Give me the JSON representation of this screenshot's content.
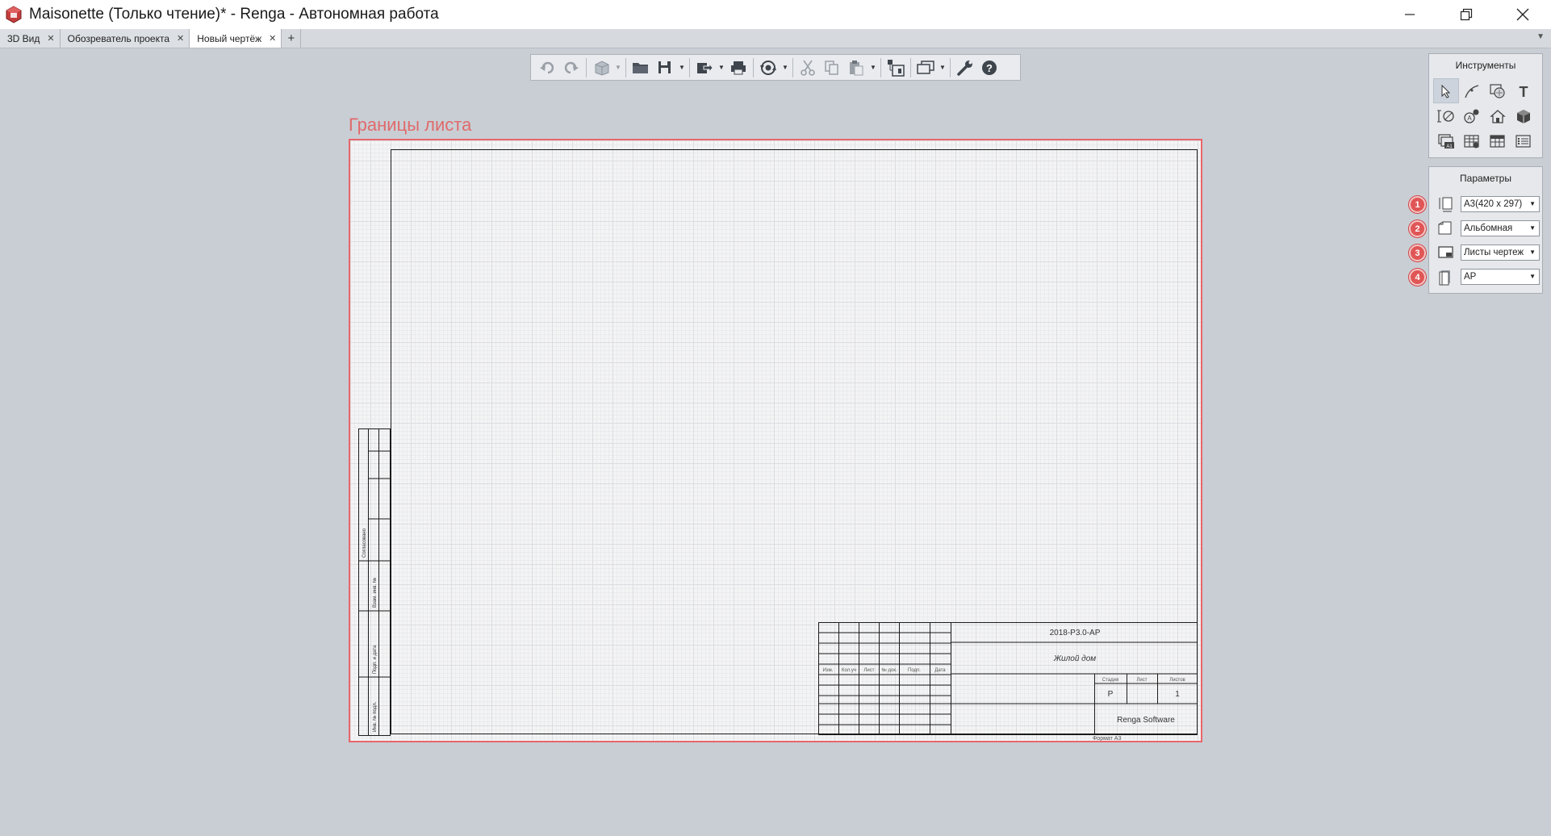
{
  "window": {
    "title": "Maisonette (Только чтение)* - Renga - Автономная работа"
  },
  "tabs": [
    {
      "label": "3D Вид",
      "active": false
    },
    {
      "label": "Обозреватель проекта",
      "active": false
    },
    {
      "label": "Новый чертёж",
      "active": true
    }
  ],
  "sheet": {
    "label": "Границы листа",
    "title_block": {
      "code": "2018-Р3.0-АР",
      "object": "Жилой дом",
      "stage_header": "Стадия",
      "sheet_header": "Лист",
      "sheets_header": "Листов",
      "stage_value": "Р",
      "sheets_value": "1",
      "company": "Renga Software",
      "format": "Формат А3",
      "col_headers": [
        "Изм.",
        "Кол.уч",
        "Лист",
        "№ док.",
        "Подп.",
        "Дата"
      ],
      "side_labels": [
        "Инв. № подл.",
        "Подп. и дата",
        "Взам. инв. №",
        "Согласовано"
      ]
    }
  },
  "tools_panel": {
    "title": "Инструменты",
    "tools": [
      "select-tool-icon",
      "line-tool-icon",
      "fill-tool-icon",
      "text-tool-icon",
      "dimension-tool-icon",
      "symbol-tool-icon",
      "view-tool-icon",
      "model-view-tool-icon",
      "title-block-tool-icon",
      "table-edit-tool-icon",
      "table-tool-icon",
      "list-tool-icon"
    ]
  },
  "params_panel": {
    "title": "Параметры",
    "params": [
      {
        "badge": "1",
        "icon": "sheet-format-icon",
        "value": "А3(420 x 297)"
      },
      {
        "badge": "2",
        "icon": "orientation-icon",
        "value": "Альбомная"
      },
      {
        "badge": "3",
        "icon": "sheet-type-icon",
        "value": "Листы чертеж"
      },
      {
        "badge": "4",
        "icon": "book-icon",
        "value": "АР"
      }
    ]
  },
  "colors": {
    "sheet_border": "#e8676b",
    "badge": "#e05656",
    "background": "#c9ced5"
  }
}
